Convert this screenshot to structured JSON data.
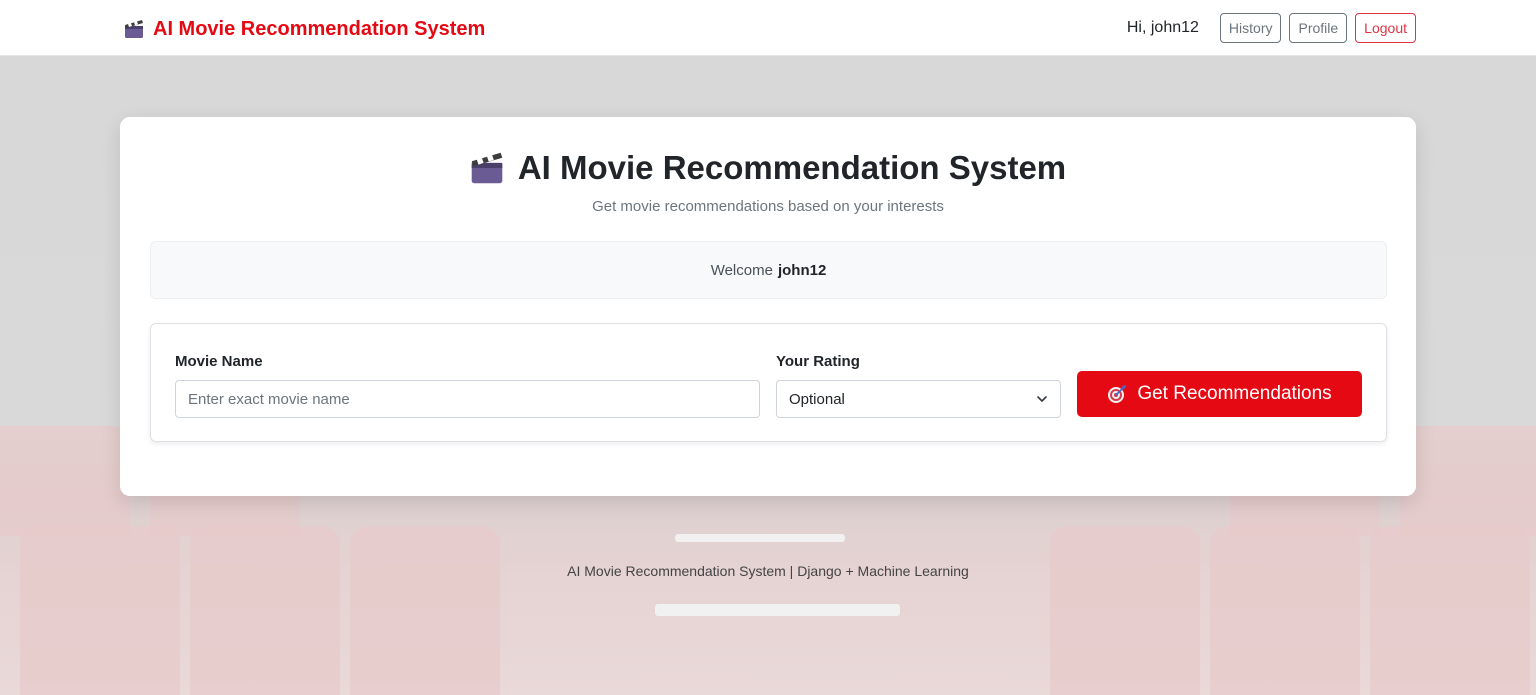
{
  "navbar": {
    "brand_icon": "clapperboard-icon",
    "brand": "AI Movie Recommendation System",
    "greeting": "Hi, john12",
    "history_label": "History",
    "profile_label": "Profile",
    "logout_label": "Logout"
  },
  "card": {
    "title_icon": "clapperboard-icon",
    "title": "AI Movie Recommendation System",
    "subtitle": "Get movie recommendations based on your interests",
    "welcome_prefix": "Welcome",
    "welcome_user": "john12"
  },
  "form": {
    "movie_label": "Movie Name",
    "movie_placeholder": "Enter exact movie name",
    "movie_value": "",
    "rating_label": "Your Rating",
    "rating_selected": "Optional",
    "submit_icon": "dart-target-icon",
    "submit_label": "Get Recommendations"
  },
  "footer": {
    "text": "AI Movie Recommendation System | Django + Machine Learning"
  },
  "colors": {
    "brand_red": "#e50914",
    "logout_red": "#dc3545",
    "secondary_gray": "#6c757d"
  }
}
